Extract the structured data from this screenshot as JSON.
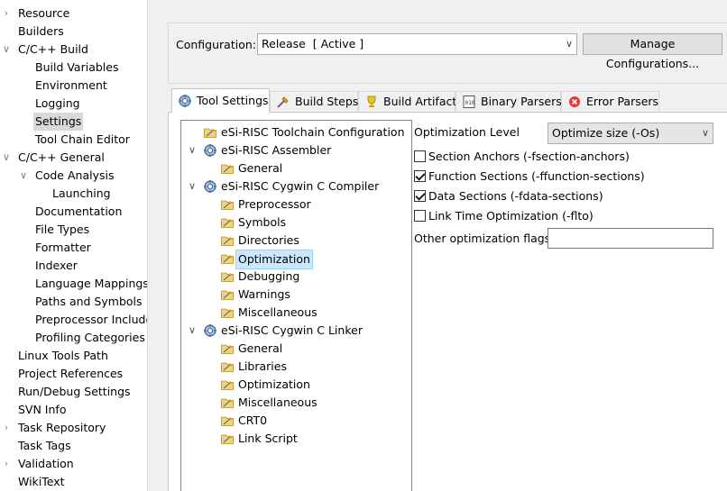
{
  "nav": {
    "items": [
      {
        "label": "Resource",
        "chevron": "›",
        "indent": 0
      },
      {
        "label": "Builders",
        "chevron": "",
        "indent": 0
      },
      {
        "label": "C/C++ Build",
        "chevron": "∨",
        "indent": 0
      },
      {
        "label": "Build Variables",
        "chevron": "",
        "indent": 1
      },
      {
        "label": "Environment",
        "chevron": "",
        "indent": 1
      },
      {
        "label": "Logging",
        "chevron": "",
        "indent": 1
      },
      {
        "label": "Settings",
        "chevron": "",
        "indent": 1,
        "selected": true
      },
      {
        "label": "Tool Chain Editor",
        "chevron": "",
        "indent": 1
      },
      {
        "label": "C/C++ General",
        "chevron": "∨",
        "indent": 0
      },
      {
        "label": "Code Analysis",
        "chevron": "∨",
        "indent": 1
      },
      {
        "label": "Launching",
        "chevron": "",
        "indent": 2
      },
      {
        "label": "Documentation",
        "chevron": "",
        "indent": 1
      },
      {
        "label": "File Types",
        "chevron": "",
        "indent": 1
      },
      {
        "label": "Formatter",
        "chevron": "",
        "indent": 1
      },
      {
        "label": "Indexer",
        "chevron": "",
        "indent": 1
      },
      {
        "label": "Language Mappings",
        "chevron": "",
        "indent": 1
      },
      {
        "label": "Paths and Symbols",
        "chevron": "",
        "indent": 1
      },
      {
        "label": "Preprocessor Include",
        "chevron": "",
        "indent": 1
      },
      {
        "label": "Profiling Categories",
        "chevron": "",
        "indent": 1
      },
      {
        "label": "Linux Tools Path",
        "chevron": "",
        "indent": 0
      },
      {
        "label": "Project References",
        "chevron": "",
        "indent": 0
      },
      {
        "label": "Run/Debug Settings",
        "chevron": "",
        "indent": 0
      },
      {
        "label": "SVN Info",
        "chevron": "",
        "indent": 0
      },
      {
        "label": "Task Repository",
        "chevron": "›",
        "indent": 0
      },
      {
        "label": "Task Tags",
        "chevron": "",
        "indent": 0
      },
      {
        "label": "Validation",
        "chevron": "›",
        "indent": 0
      },
      {
        "label": "WikiText",
        "chevron": "",
        "indent": 0
      }
    ]
  },
  "config": {
    "label": "Configuration:",
    "value": "Release  [ Active ]",
    "manage_label": "Manage Configurations..."
  },
  "tabs": [
    {
      "label": "Tool Settings",
      "icon": "gear-settings-icon",
      "active": true
    },
    {
      "label": "Build Steps",
      "icon": "build-steps-icon"
    },
    {
      "label": "Build Artifact",
      "icon": "trophy-icon"
    },
    {
      "label": "Binary Parsers",
      "icon": "binary-icon"
    },
    {
      "label": "Error Parsers",
      "icon": "error-icon"
    }
  ],
  "tool_tree": [
    {
      "label": "eSi-RISC Toolchain Configuration",
      "type": "folder",
      "level": 0,
      "chevron": ""
    },
    {
      "label": "eSi-RISC Assembler",
      "type": "gear",
      "level": 0,
      "chevron": "∨"
    },
    {
      "label": "General",
      "type": "folder",
      "level": 1,
      "chevron": ""
    },
    {
      "label": "eSi-RISC Cygwin C Compiler",
      "type": "gear",
      "level": 0,
      "chevron": "∨"
    },
    {
      "label": "Preprocessor",
      "type": "folder",
      "level": 1,
      "chevron": ""
    },
    {
      "label": "Symbols",
      "type": "folder",
      "level": 1,
      "chevron": ""
    },
    {
      "label": "Directories",
      "type": "folder",
      "level": 1,
      "chevron": ""
    },
    {
      "label": "Optimization",
      "type": "folder",
      "level": 1,
      "chevron": "",
      "selected": true
    },
    {
      "label": "Debugging",
      "type": "folder",
      "level": 1,
      "chevron": ""
    },
    {
      "label": "Warnings",
      "type": "folder",
      "level": 1,
      "chevron": ""
    },
    {
      "label": "Miscellaneous",
      "type": "folder",
      "level": 1,
      "chevron": ""
    },
    {
      "label": "eSi-RISC Cygwin C Linker",
      "type": "gear",
      "level": 0,
      "chevron": "∨"
    },
    {
      "label": "General",
      "type": "folder",
      "level": 1,
      "chevron": ""
    },
    {
      "label": "Libraries",
      "type": "folder",
      "level": 1,
      "chevron": ""
    },
    {
      "label": "Optimization",
      "type": "folder",
      "level": 1,
      "chevron": ""
    },
    {
      "label": "Miscellaneous",
      "type": "folder",
      "level": 1,
      "chevron": ""
    },
    {
      "label": "CRT0",
      "type": "folder",
      "level": 1,
      "chevron": ""
    },
    {
      "label": "Link Script",
      "type": "folder",
      "level": 1,
      "chevron": ""
    }
  ],
  "options": {
    "level_label": "Optimization Level",
    "level_value": "Optimize size (-Os)",
    "checkboxes": [
      {
        "label": "Section Anchors (-fsection-anchors)",
        "checked": false
      },
      {
        "label": "Function Sections (-ffunction-sections)",
        "checked": true
      },
      {
        "label": "Data Sections (-fdata-sections)",
        "checked": true
      },
      {
        "label": "Link Time Optimization (-flto)",
        "checked": false
      }
    ],
    "other_label": "Other optimization flags",
    "other_value": ""
  }
}
